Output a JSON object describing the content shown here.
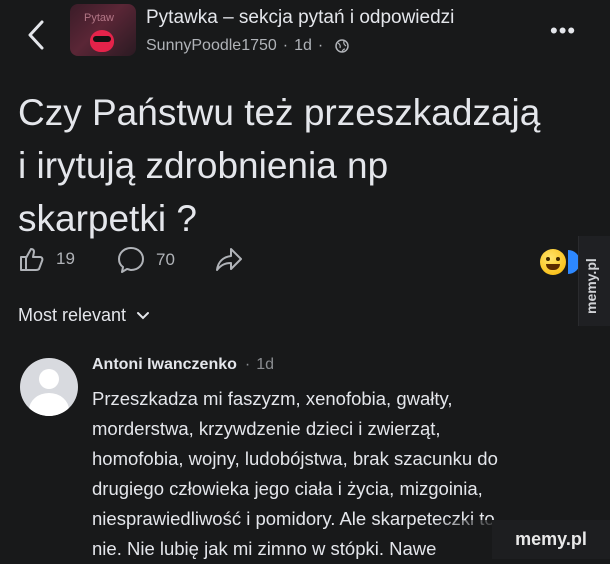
{
  "header": {
    "group_name": "Pytawka – sekcja pytań i odpowiedzi",
    "avatar_watermark": "Pytaw",
    "author": "SunnyPoodle1750",
    "separator": "·",
    "time": "1d",
    "more_label": "•••"
  },
  "post": {
    "lines": [
      "Czy Państwu też przeszkadzają",
      "i irytują zdrobnienia np",
      "skarpetki ?"
    ],
    "likes": "19",
    "comments": "70"
  },
  "sort": {
    "label": "Most relevant"
  },
  "comment": {
    "author": "Antoni Iwanczenko",
    "separator": "·",
    "time": "1d",
    "lines": [
      "Przeszkadza mi faszyzm, xenofobia, gwałty,",
      "morderstwa, krzywdzenie dzieci i zwierząt,",
      "homofobia, wojny, ludobójstwa, brak szacunku do",
      "drugiego człowieka jego ciała i życia, mizgoinia,",
      "niesprawiedliwość i pomidory. Ale skarpeteczki to",
      "nie. Nie lubię jak mi zimno w stópki. Nawe"
    ]
  },
  "watermarks": {
    "side": "memy.pl",
    "corner": "memy.pl"
  },
  "colors": {
    "background": "#18191a",
    "text": "#e4e6eb",
    "muted": "#b0b3b8",
    "accent": "#2d88ff"
  },
  "icons": [
    "back-arrow-icon",
    "globe-icon",
    "more-icon",
    "like-icon",
    "comment-icon",
    "share-icon",
    "chevron-down-icon",
    "haha-reaction-icon",
    "like-reaction-icon"
  ]
}
